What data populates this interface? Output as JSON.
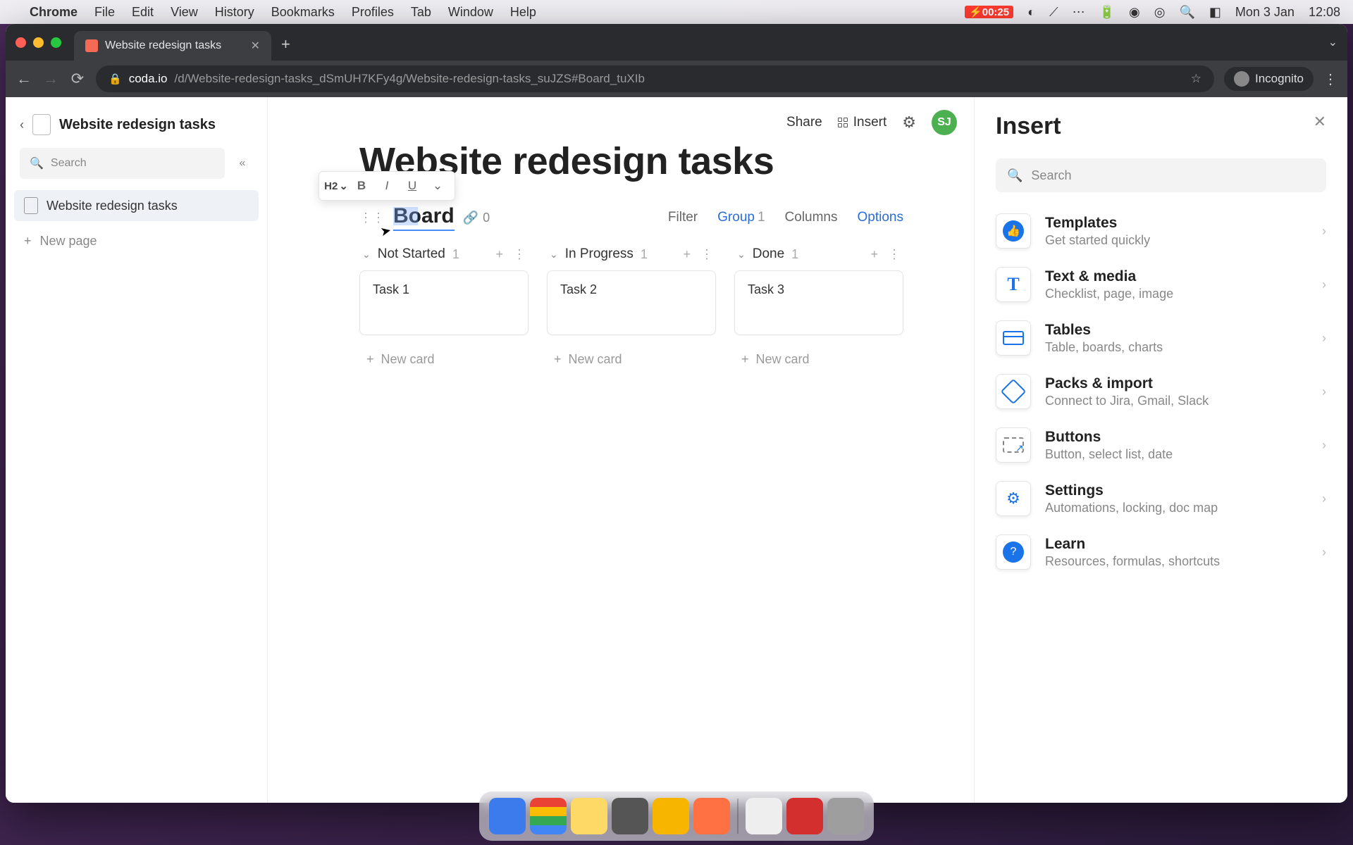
{
  "menubar": {
    "app": "Chrome",
    "items": [
      "File",
      "Edit",
      "View",
      "History",
      "Bookmarks",
      "Profiles",
      "Tab",
      "Window",
      "Help"
    ],
    "battery": "00:25",
    "date": "Mon 3 Jan",
    "time": "12:08"
  },
  "browser": {
    "tab_title": "Website redesign tasks",
    "url_domain": "coda.io",
    "url_path": "/d/Website-redesign-tasks_dSmUH7KFy4g/Website-redesign-tasks_suJZS#Board_tuXIb",
    "incognito": "Incognito"
  },
  "sidebar": {
    "doc_title": "Website redesign tasks",
    "search_placeholder": "Search",
    "pages": [
      "Website redesign tasks"
    ],
    "new_page": "New page"
  },
  "top_actions": {
    "share": "Share",
    "insert": "Insert",
    "avatar": "SJ"
  },
  "page": {
    "title": "Website redesign tasks",
    "fmt_heading": "H2",
    "board": {
      "name": "Board",
      "link_count": "0",
      "controls": {
        "filter": "Filter",
        "group": "Group",
        "group_count": "1",
        "columns": "Columns",
        "options": "Options"
      },
      "cols": [
        {
          "title": "Not Started",
          "count": "1",
          "cards": [
            "Task 1"
          ],
          "new_card": "New card"
        },
        {
          "title": "In Progress",
          "count": "1",
          "cards": [
            "Task 2"
          ],
          "new_card": "New card"
        },
        {
          "title": "Done",
          "count": "1",
          "cards": [
            "Task 3"
          ],
          "new_card": "New card"
        }
      ]
    }
  },
  "insert_panel": {
    "title": "Insert",
    "search_placeholder": "Search",
    "categories": [
      {
        "name": "Templates",
        "desc": "Get started quickly",
        "icon": "thumb"
      },
      {
        "name": "Text & media",
        "desc": "Checklist, page, image",
        "icon": "T"
      },
      {
        "name": "Tables",
        "desc": "Table, boards, charts",
        "icon": "table"
      },
      {
        "name": "Packs & import",
        "desc": "Connect to Jira, Gmail, Slack",
        "icon": "pack"
      },
      {
        "name": "Buttons",
        "desc": "Button, select list, date",
        "icon": "button"
      },
      {
        "name": "Settings",
        "desc": "Automations, locking, doc map",
        "icon": "gear"
      },
      {
        "name": "Learn",
        "desc": "Resources, formulas, shortcuts",
        "icon": "help"
      }
    ]
  }
}
